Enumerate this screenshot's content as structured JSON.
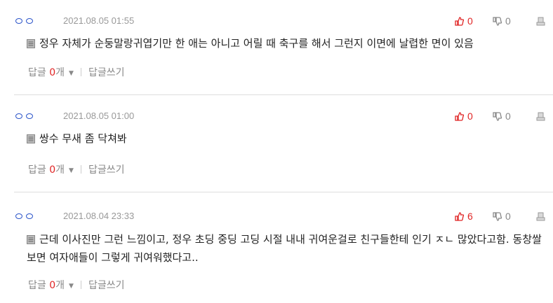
{
  "comments": [
    {
      "date": "2021.08.05 01:55",
      "upvotes": "0",
      "downvotes": "0",
      "text": "정우 자체가 순둥말랑귀엽기만 한 애는 아니고 어릴 때 축구를 해서 그런지 이면에 날렵한 면이 있음",
      "reply_label": "답글",
      "reply_count": "0",
      "reply_suffix": "개",
      "write_reply": "답글쓰기"
    },
    {
      "date": "2021.08.05 01:00",
      "upvotes": "0",
      "downvotes": "0",
      "text": "쌍수 무새 좀 닥쳐봐",
      "reply_label": "답글",
      "reply_count": "0",
      "reply_suffix": "개",
      "write_reply": "답글쓰기"
    },
    {
      "date": "2021.08.04 23:33",
      "upvotes": "6",
      "downvotes": "0",
      "text": "근데 이사진만 그런 느낌이고, 정우 초딩 중딩 고딩 시절 내내 귀여운걸로 친구들한테 인기 ㅈㄴ 많았다고함. 동창쌀 보면 여자애들이 그렇게 귀여워했다고..",
      "reply_label": "답글",
      "reply_count": "0",
      "reply_suffix": "개",
      "write_reply": "답글쓰기"
    }
  ],
  "colors": {
    "nickname_icon": "#2a53c9",
    "upvote": "#e02424",
    "downvote": "#888888",
    "date": "#999999"
  }
}
